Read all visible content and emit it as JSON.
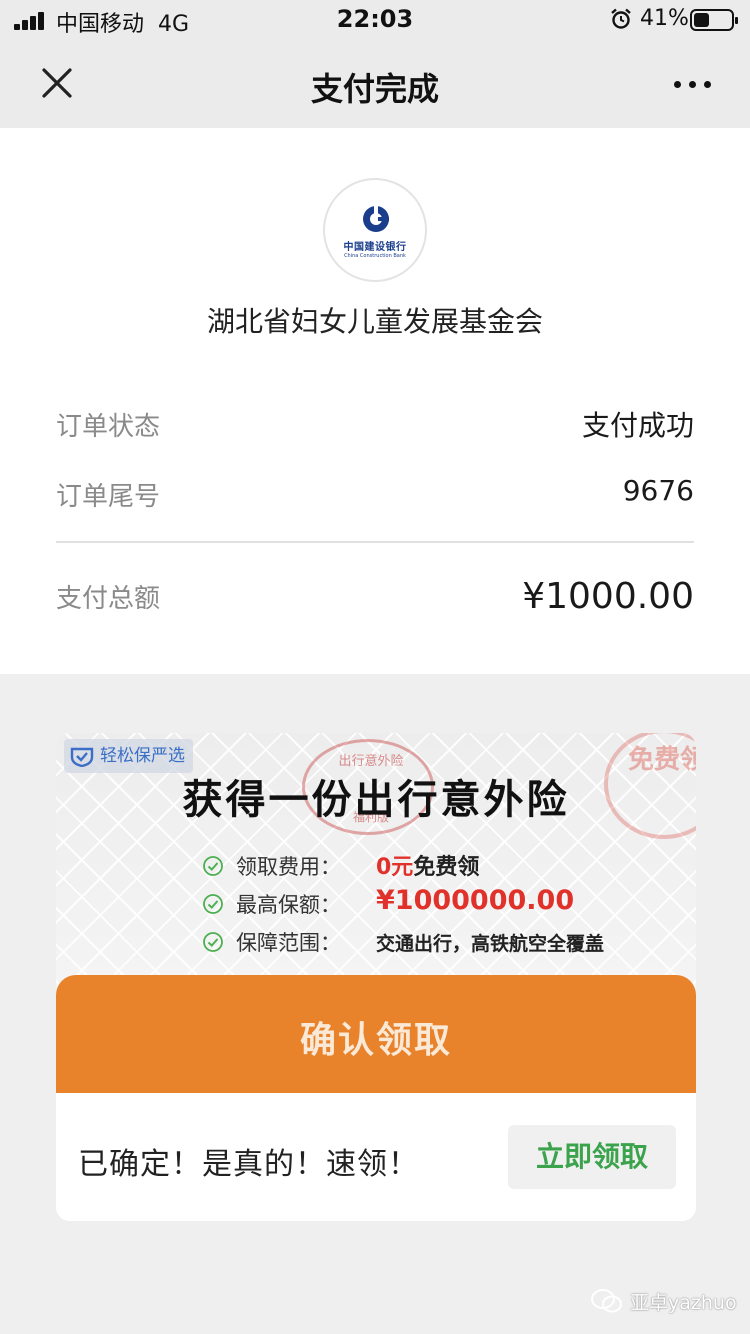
{
  "status_bar": {
    "carrier": "中国移动",
    "network": "4G",
    "time": "22:03",
    "battery_percent": "41%",
    "battery_level": 0.41
  },
  "nav": {
    "title": "支付完成",
    "close_icon": "close-icon",
    "more_icon": "more-icon"
  },
  "receipt": {
    "bank_logo_text_cn": "中国建设银行",
    "bank_logo_text_en": "China Construction Bank",
    "merchant": "湖北省妇女儿童发展基金会",
    "rows": [
      {
        "label": "订单状态",
        "value": "支付成功"
      },
      {
        "label": "订单尾号",
        "value": "9676"
      }
    ],
    "total": {
      "label": "支付总额",
      "value": "¥1000.00"
    }
  },
  "ad": {
    "brand": "轻松保严选",
    "headline": "获得一份出行意外险",
    "stamp_top": "出行意外险",
    "stamp_bottom": "福利版",
    "corner_seal": "免费领",
    "features": [
      {
        "label": "领取费用：",
        "value_red": "0元",
        "value_dark": "免费领"
      },
      {
        "label": "最高保额：",
        "value_red": "¥1000000.00",
        "value_dark": ""
      },
      {
        "label": "保障范围：",
        "value_red": "",
        "value_dark": "交通出行，高铁航空全覆盖"
      }
    ],
    "confirm_button": "确认领取",
    "slogan": "已确定！是真的！速领！",
    "claim_button": "立即领取"
  },
  "watermark": "亚卓yazhuo",
  "colors": {
    "accent_orange": "#e8822b",
    "red": "#e0322b",
    "green": "#3ca34d",
    "bank_blue": "#1a3e8c"
  }
}
